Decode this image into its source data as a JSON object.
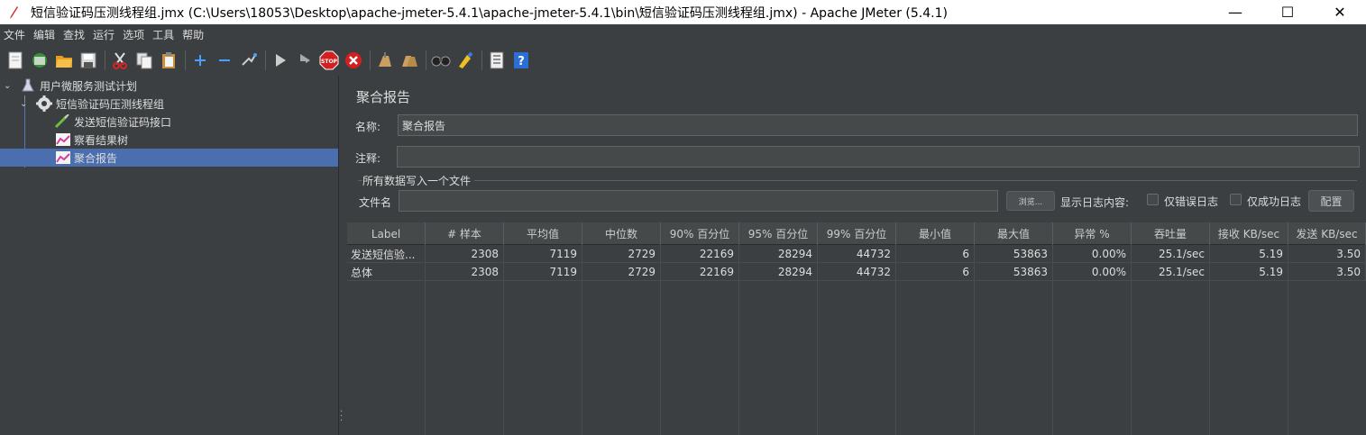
{
  "window": {
    "title": "短信验证码压测线程组.jmx (C:\\Users\\18053\\Desktop\\apache-jmeter-5.4.1\\apache-jmeter-5.4.1\\bin\\短信验证码压测线程组.jmx) - Apache JMeter (5.4.1)",
    "minimize": "—",
    "maximize": "☐",
    "close": "✕"
  },
  "menu": [
    "文件",
    "编辑",
    "查找",
    "运行",
    "选项",
    "工具",
    "帮助"
  ],
  "tree": {
    "items": [
      {
        "label": "用户微服务测试计划",
        "icon": "flask-icon"
      },
      {
        "label": "短信验证码压测线程组",
        "icon": "gear-icon"
      },
      {
        "label": "发送短信验证码接口",
        "icon": "pipette-icon"
      },
      {
        "label": "察看结果树",
        "icon": "chart-icon"
      },
      {
        "label": "聚合报告",
        "icon": "chart-icon"
      }
    ]
  },
  "panel": {
    "title": "聚合报告",
    "name_label": "名称:",
    "name_value": "聚合报告",
    "comment_label": "注释:",
    "comment_value": "",
    "file_group_title": "所有数据写入一个文件",
    "filename_label": "文件名",
    "filename_value": "",
    "browse_label": "浏览...",
    "log_content_label": "显示日志内容:",
    "errors_only_label": "仅错误日志",
    "success_only_label": "仅成功日志",
    "configure_label": "配置"
  },
  "table": {
    "columns": [
      "Label",
      "# 样本",
      "平均值",
      "中位数",
      "90% 百分位",
      "95% 百分位",
      "99% 百分位",
      "最小值",
      "最大值",
      "异常 %",
      "吞吐量",
      "接收 KB/sec",
      "发送 KB/sec"
    ],
    "rows": [
      [
        "发送短信验...",
        "2308",
        "7119",
        "2729",
        "22169",
        "28294",
        "44732",
        "6",
        "53863",
        "0.00%",
        "25.1/sec",
        "5.19",
        "3.50"
      ],
      [
        "总体",
        "2308",
        "7119",
        "2729",
        "22169",
        "28294",
        "44732",
        "6",
        "53863",
        "0.00%",
        "25.1/sec",
        "5.19",
        "3.50"
      ]
    ]
  },
  "colors": {
    "background": "#3c3f41",
    "selection": "#4b6eaf",
    "text": "#dddddd"
  }
}
